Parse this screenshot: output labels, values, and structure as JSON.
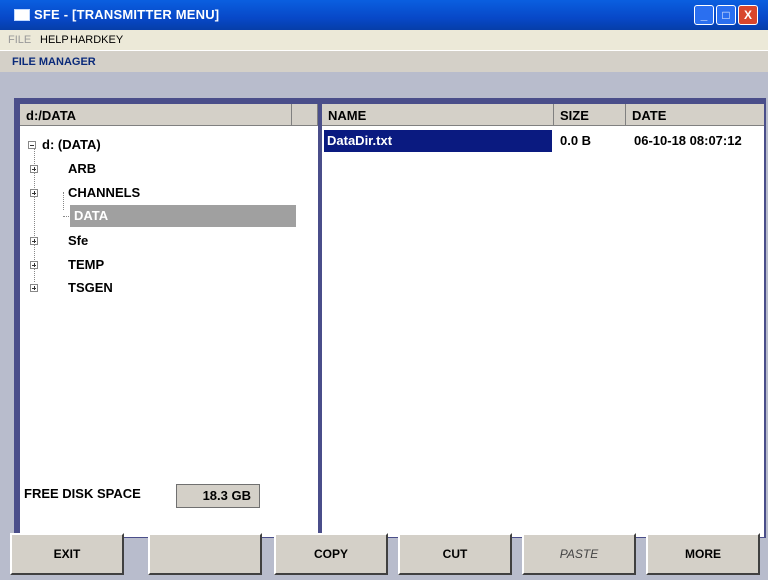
{
  "window": {
    "title": "SFE - [TRANSMITTER MENU]",
    "min_glyph": "_",
    "max_glyph": "□",
    "close_glyph": "X"
  },
  "menu": {
    "items": [
      "FILE",
      "HELP",
      "HARDKEY"
    ]
  },
  "section": {
    "title": "FILE MANAGER"
  },
  "tree": {
    "header": "d:/DATA",
    "root": "d: (DATA)",
    "folders": [
      "ARB",
      "CHANNELS",
      "DATA",
      "Sfe",
      "TEMP",
      "TSGEN"
    ],
    "selected": "DATA"
  },
  "files": {
    "columns": [
      "NAME",
      "SIZE",
      "DATE"
    ],
    "rows": [
      {
        "name": "DataDir.txt",
        "size": "0.0 B",
        "date": "06-10-18 08:07:12"
      }
    ]
  },
  "disk": {
    "label": "FREE DISK SPACE",
    "value": "18.3 GB"
  },
  "softkeys": [
    "EXIT",
    "",
    "COPY",
    "CUT",
    "PASTE",
    "MORE"
  ],
  "colors": {
    "titlebar": "#0748c8",
    "selection": "#0a1a80",
    "frame": "#4a4e8a"
  }
}
